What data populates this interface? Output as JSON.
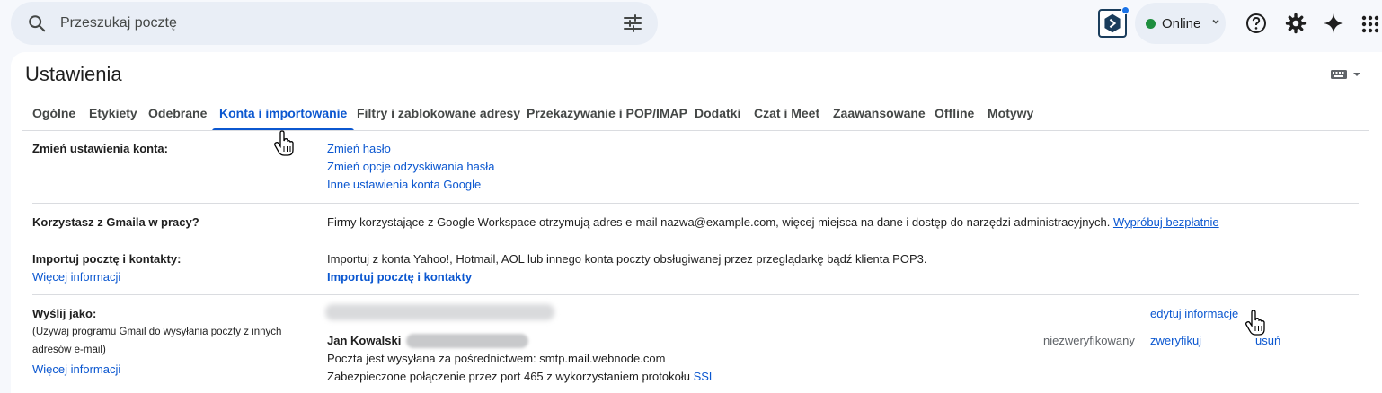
{
  "search": {
    "placeholder": "Przeszukaj pocztę"
  },
  "topbar": {
    "status_label": "Online"
  },
  "colors": {
    "accent": "#0b57d0",
    "online": "#1e8e3e",
    "search_bg": "#e9eef6"
  },
  "icons": [
    "search-icon",
    "filter-options-icon",
    "extension-icon",
    "chevron-down-icon",
    "help-icon",
    "gear-icon",
    "gemini-sparkle-icon",
    "apps-grid-icon",
    "keyboard-icon",
    "hand-cursor-icon"
  ],
  "page": {
    "title": "Ustawienia"
  },
  "tabs": [
    {
      "label": "Ogólne"
    },
    {
      "label": "Etykiety"
    },
    {
      "label": "Odebrane"
    },
    {
      "label": "Konta i importowanie",
      "active": true
    },
    {
      "label": "Filtry i zablokowane adresy"
    },
    {
      "label": "Przekazywanie i POP/IMAP"
    },
    {
      "label": "Dodatki"
    },
    {
      "label": "Czat i Meet"
    },
    {
      "label": "Zaawansowane"
    },
    {
      "label": "Offline"
    },
    {
      "label": "Motywy"
    }
  ],
  "sections": {
    "account": {
      "label": "Zmień ustawienia konta:",
      "links": [
        "Zmień hasło",
        "Zmień opcje odzyskiwania hasła",
        "Inne ustawienia konta Google"
      ]
    },
    "work": {
      "label": "Korzystasz z Gmaila w pracy?",
      "text": "Firmy korzystające z Google Workspace otrzymują adres e-mail nazwa@example.com, więcej miejsca na dane i dostęp do narzędzi administracyjnych.",
      "link": "Wypróbuj bezpłatnie"
    },
    "import": {
      "label": "Importuj pocztę i kontakty:",
      "more": "Więcej informacji",
      "text": "Importuj z konta Yahoo!, Hotmail, AOL lub innego konta poczty obsługiwanej przez przeglądarkę bądź klienta POP3.",
      "action": "Importuj pocztę i kontakty"
    },
    "sendas": {
      "label": "Wyślij jako:",
      "description": "(Używaj programu Gmail do wysyłania poczty z innych adresów e-mail)",
      "more": "Więcej informacji",
      "edit": "edytuj informacje",
      "name": "Jan Kowalski",
      "status": "niezweryfikowany",
      "verify": "zweryfikuj",
      "remove": "usuń",
      "smtp": "Poczta jest wysyłana za pośrednictwem: smtp.mail.webnode.com",
      "secure_text": "Zabezpieczone połączenie przez port 465 z wykorzystaniem protokołu",
      "secure_link": "SSL"
    }
  }
}
